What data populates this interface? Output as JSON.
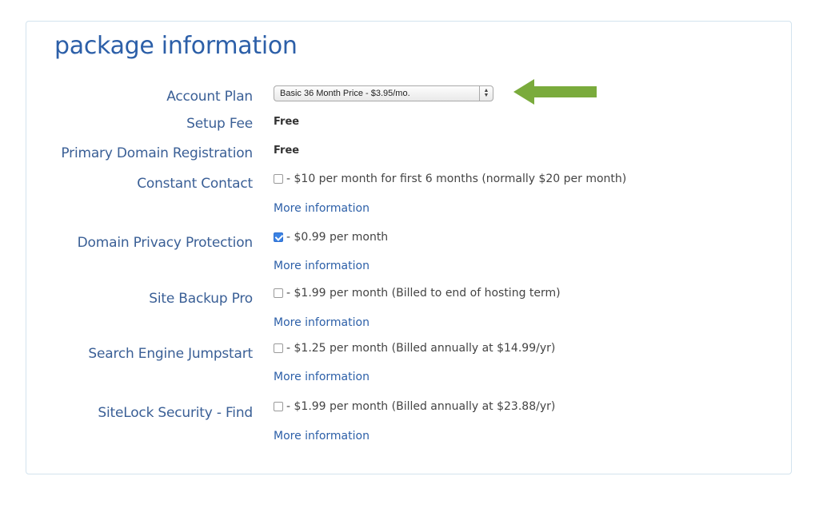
{
  "title": "package information",
  "rows": {
    "account_plan": {
      "label": "Account Plan",
      "selected": "Basic 36 Month Price - $3.95/mo."
    },
    "setup_fee": {
      "label": "Setup Fee",
      "value": "Free"
    },
    "primary_domain": {
      "label": "Primary Domain Registration",
      "value": "Free"
    },
    "constant_contact": {
      "label": "Constant Contact",
      "checked": false,
      "text": "- $10 per month for first 6 months (normally $20 per month)",
      "more": "More information"
    },
    "domain_privacy": {
      "label": "Domain Privacy Protection",
      "checked": true,
      "text": "- $0.99 per month",
      "more": "More information"
    },
    "site_backup": {
      "label": "Site Backup Pro",
      "checked": false,
      "text": "- $1.99 per month (Billed to end of hosting term)",
      "more": "More information"
    },
    "seo_jumpstart": {
      "label": "Search Engine Jumpstart",
      "checked": false,
      "text": "- $1.25 per month (Billed annually at $14.99/yr)",
      "more": "More information"
    },
    "sitelock": {
      "label": "SiteLock Security - Find",
      "checked": false,
      "text": "- $1.99 per month (Billed annually at $23.88/yr)",
      "more": "More information"
    }
  },
  "colors": {
    "accent": "#2c5fa8",
    "label": "#3a5f96",
    "arrow": "#7aab3c",
    "checkbox_checked": "#3b82e3",
    "panel_border": "#d3e3ee"
  },
  "icons": {
    "select": "up-down-chevron-icon",
    "pointer": "green-arrow-left-icon"
  }
}
